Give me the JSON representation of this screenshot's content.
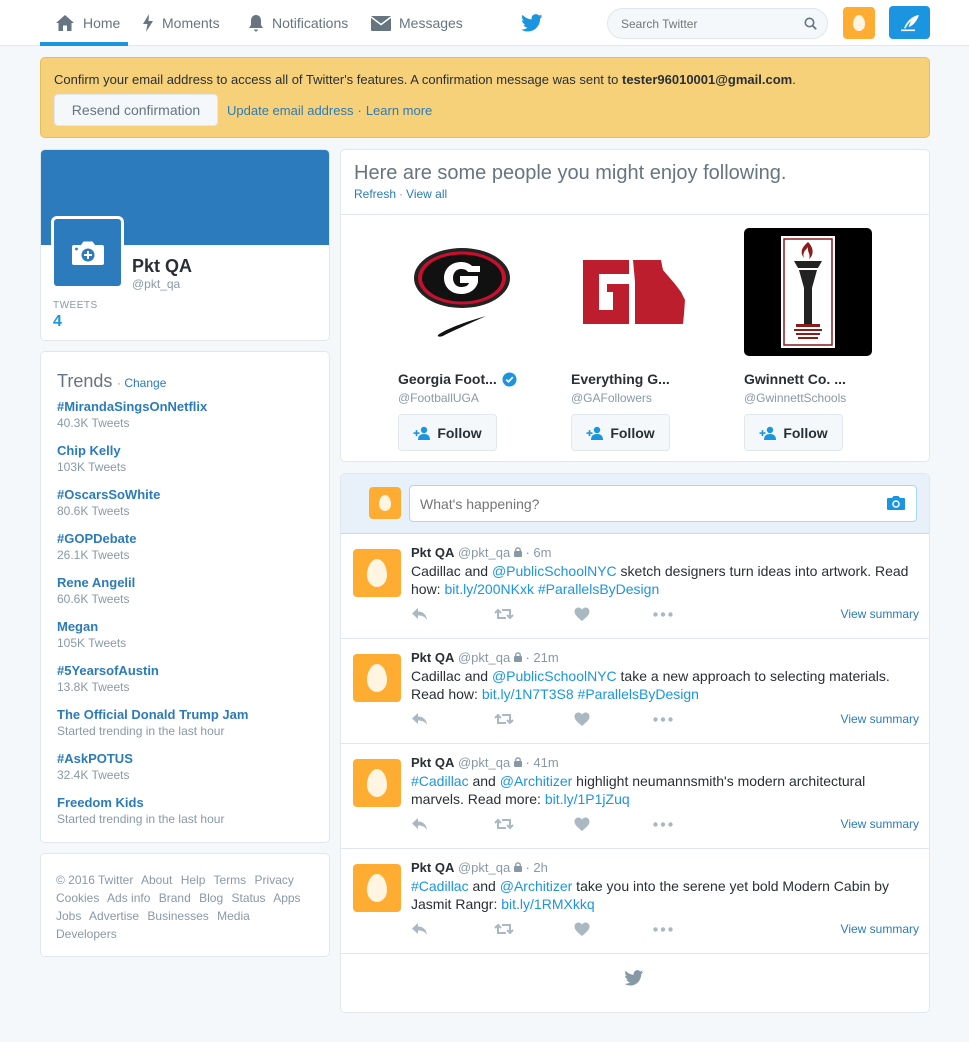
{
  "nav": {
    "home": "Home",
    "moments": "Moments",
    "notifications": "Notifications",
    "messages": "Messages",
    "search_placeholder": "Search Twitter"
  },
  "banner": {
    "text": "Confirm your email address to access all of Twitter's features. A confirmation message was sent to ",
    "email": "tester96010001@gmail.com",
    "period": ".",
    "resend": "Resend confirmation",
    "update": "Update email address",
    "separator": "·",
    "learn_more": "Learn more"
  },
  "profile": {
    "name": "Pkt QA",
    "handle": "@pkt_qa",
    "tweets_label": "TWEETS",
    "tweets_count": "4"
  },
  "trends": {
    "title": "Trends",
    "separator": "·",
    "change": "Change",
    "items": [
      {
        "name": "#MirandaSingsOnNetflix",
        "count": "40.3K Tweets"
      },
      {
        "name": "Chip Kelly",
        "count": "103K Tweets"
      },
      {
        "name": "#OscarsSoWhite",
        "count": "80.6K Tweets"
      },
      {
        "name": "#GOPDebate",
        "count": "26.1K Tweets"
      },
      {
        "name": "Rene Angelil",
        "count": "60.6K Tweets"
      },
      {
        "name": "Megan",
        "count": "105K Tweets"
      },
      {
        "name": "#5YearsofAustin",
        "count": "13.8K Tweets"
      },
      {
        "name": "The Official Donald Trump Jam",
        "count": "Started trending in the last hour"
      },
      {
        "name": "#AskPOTUS",
        "count": "32.4K Tweets"
      },
      {
        "name": "Freedom Kids",
        "count": "Started trending in the last hour"
      }
    ]
  },
  "footer": {
    "links": [
      "© 2016 Twitter",
      "About",
      "Help",
      "Terms",
      "Privacy",
      "Cookies",
      "Ads info",
      "Brand",
      "Blog",
      "Status",
      "Apps",
      "Jobs",
      "Advertise",
      "Businesses",
      "Media",
      "Developers"
    ]
  },
  "wtf": {
    "title": "Here are some people you might enjoy following.",
    "refresh": "Refresh",
    "separator": "·",
    "view_all": "View all",
    "follow_label": "Follow",
    "people": [
      {
        "name": "Georgia Foot...",
        "handle": "@FootballUGA",
        "verified": true
      },
      {
        "name": "Everything G...",
        "handle": "@GAFollowers",
        "verified": false
      },
      {
        "name": "Gwinnett Co. ...",
        "handle": "@GwinnettSchools",
        "verified": false
      }
    ]
  },
  "composer": {
    "placeholder": "What's happening?"
  },
  "tweets": [
    {
      "name": "Pkt QA",
      "handle": "@pkt_qa",
      "time": "6m",
      "parts": [
        {
          "t": "Cadillac and ",
          "link": false
        },
        {
          "t": "@PublicSchoolNYC",
          "link": true
        },
        {
          "t": " sketch designers turn ideas into artwork. Read how: ",
          "link": false
        },
        {
          "t": "bit.ly/200NKxk",
          "link": true
        },
        {
          "t": " ",
          "link": false
        },
        {
          "t": "#ParallelsByDesign",
          "link": true
        }
      ],
      "view_summary": "View summary"
    },
    {
      "name": "Pkt QA",
      "handle": "@pkt_qa",
      "time": "21m",
      "parts": [
        {
          "t": "Cadillac and ",
          "link": false
        },
        {
          "t": "@PublicSchoolNYC",
          "link": true
        },
        {
          "t": " take a new approach to selecting materials. Read how: ",
          "link": false
        },
        {
          "t": "bit.ly/1N7T3S8",
          "link": true
        },
        {
          "t": " ",
          "link": false
        },
        {
          "t": "#ParallelsByDesign",
          "link": true
        }
      ],
      "view_summary": "View summary"
    },
    {
      "name": "Pkt QA",
      "handle": "@pkt_qa",
      "time": "41m",
      "parts": [
        {
          "t": "#Cadillac",
          "link": true
        },
        {
          "t": " and ",
          "link": false
        },
        {
          "t": "@Architizer",
          "link": true
        },
        {
          "t": " highlight neumannsmith's modern architectural marvels. Read more: ",
          "link": false
        },
        {
          "t": "bit.ly/1P1jZuq",
          "link": true
        }
      ],
      "view_summary": "View summary"
    },
    {
      "name": "Pkt QA",
      "handle": "@pkt_qa",
      "time": "2h",
      "parts": [
        {
          "t": "#Cadillac",
          "link": true
        },
        {
          "t": " and ",
          "link": false
        },
        {
          "t": "@Architizer",
          "link": true
        },
        {
          "t": " take you into the serene yet bold Modern Cabin by Jasmit Rangr: ",
          "link": false
        },
        {
          "t": "bit.ly/1RMXkkq",
          "link": true
        }
      ],
      "view_summary": "View summary"
    }
  ],
  "colors": {
    "brand": "#1b95e0",
    "banner_bg": "#f6d17a",
    "egg_avatar": "#ffac33",
    "profile_header": "#2c7bbd"
  }
}
